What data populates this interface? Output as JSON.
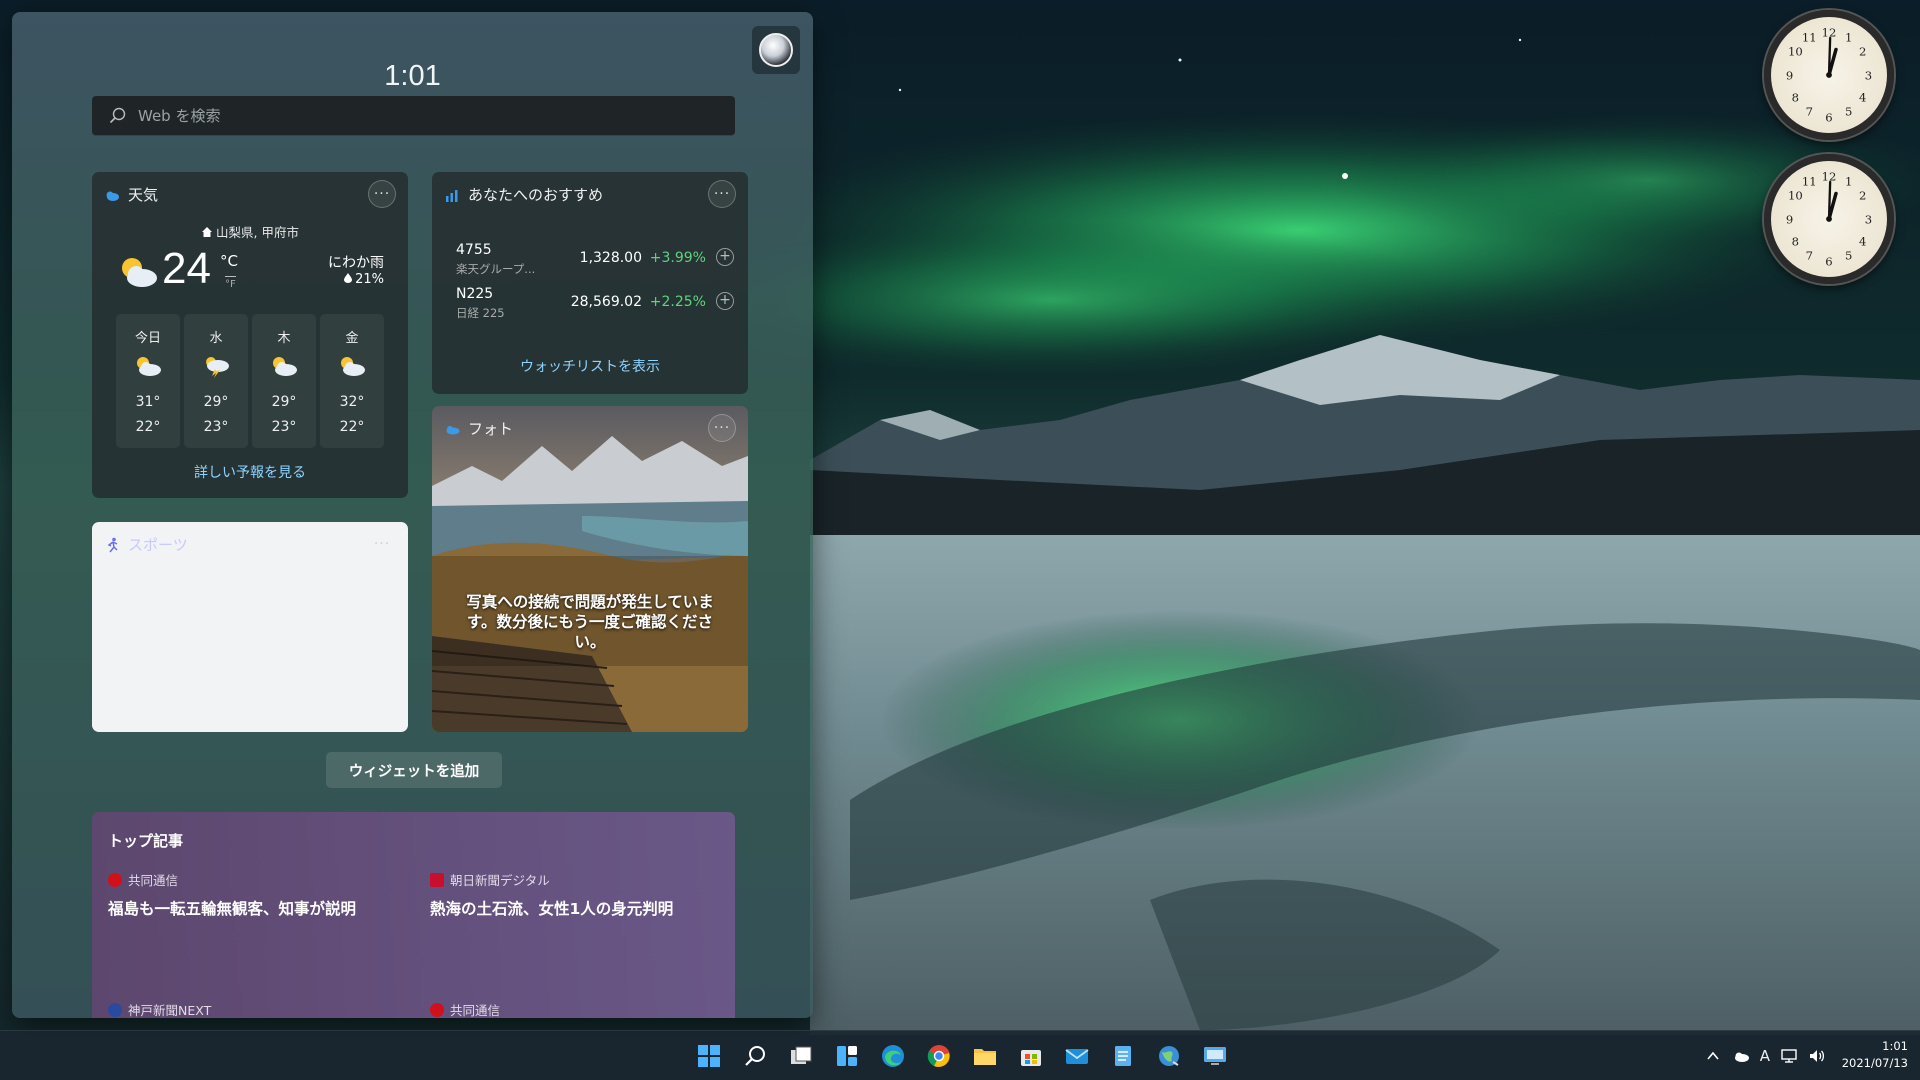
{
  "panel": {
    "time": "1:01",
    "search_placeholder": "Web を検索"
  },
  "weather": {
    "title": "天気",
    "location": "山梨県, 甲府市",
    "temperature": "24",
    "unit_c": "°C",
    "unit_f": "°F",
    "condition": "にわか雨",
    "precip": "21%",
    "days": [
      {
        "day": "今日",
        "hi": "31°",
        "lo": "22°",
        "icon": "partly-cloudy-icon"
      },
      {
        "day": "水",
        "hi": "29°",
        "lo": "23°",
        "icon": "thunderstorm-icon"
      },
      {
        "day": "木",
        "hi": "29°",
        "lo": "23°",
        "icon": "partly-cloudy-icon"
      },
      {
        "day": "金",
        "hi": "32°",
        "lo": "22°",
        "icon": "partly-cloudy-icon"
      }
    ],
    "link": "詳しい予報を見る"
  },
  "stocks": {
    "title": "あなたへのおすすめ",
    "rows": [
      {
        "symbol": "4755",
        "name": "楽天グループ...",
        "price": "1,328.00",
        "change": "+3.99%"
      },
      {
        "symbol": "N225",
        "name": "日経 225",
        "price": "28,569.02",
        "change": "+2.25%"
      }
    ],
    "link": "ウォッチリストを表示"
  },
  "photos": {
    "title": "フォト",
    "message": "写真への接続で問題が発生しています。数分後にもう一度ご確認ください。"
  },
  "sports": {
    "title": "スポーツ"
  },
  "add_widgets": "ウィジェットを追加",
  "top_stories": {
    "title": "トップ記事",
    "items": [
      {
        "source": "共同通信",
        "headline": "福島も一転五輪無観客、知事が説明",
        "logo_color": "#d0101a"
      },
      {
        "source": "朝日新聞デジタル",
        "headline": "熱海の土石流、女性1人の身元判明",
        "logo_color": "#c8102e"
      },
      {
        "source": "神戸新聞NEXT",
        "headline": "",
        "logo_color": "#2a4aa0"
      },
      {
        "source": "共同通信",
        "headline": "",
        "logo_color": "#d0101a"
      }
    ]
  },
  "taskbar": {
    "icons": [
      "start-icon",
      "search-icon",
      "task-view-icon",
      "widgets-icon",
      "edge-icon",
      "chrome-icon",
      "file-explorer-icon",
      "store-icon",
      "mail-icon",
      "notepad-icon",
      "network-globe-icon",
      "remote-desktop-icon"
    ],
    "ime": "A",
    "time": "1:01",
    "date": "2021/07/13"
  },
  "colors": {
    "accent_link": "#8fd3ff",
    "stock_up": "#5fd37d",
    "top_stories_bg": "#6e5888"
  }
}
